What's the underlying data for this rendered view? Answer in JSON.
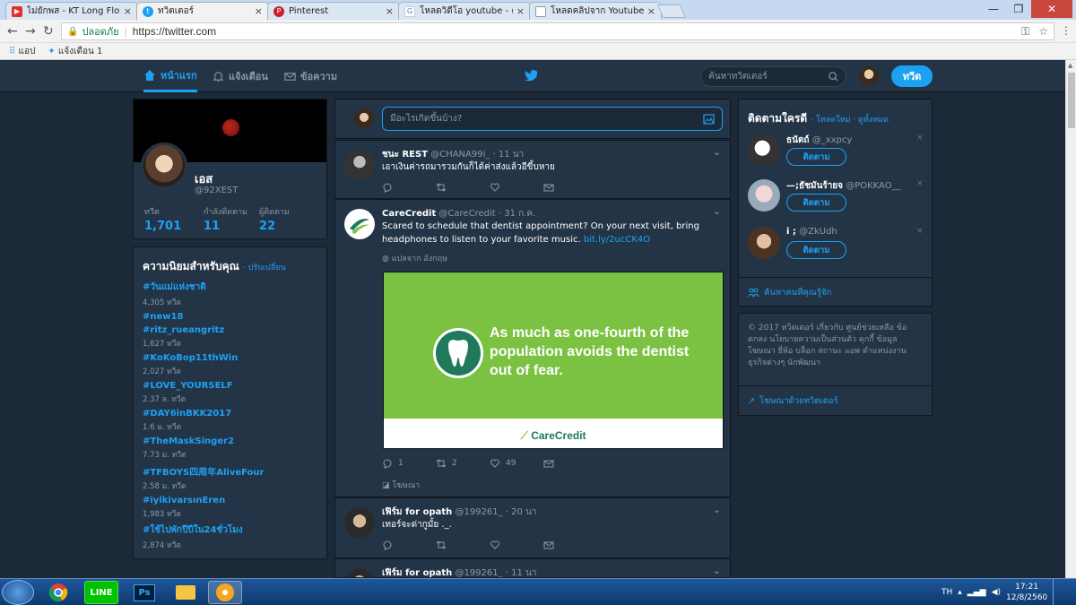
{
  "browser": {
    "tabs": [
      {
        "title": "ไม่ยักพส - KT Long Flowin",
        "favicon": "youtube-icon",
        "active": false
      },
      {
        "title": "ทวิตเตอร์",
        "favicon": "twitter-icon",
        "active": true
      },
      {
        "title": "Pinterest",
        "favicon": "pinterest-icon",
        "active": false
      },
      {
        "title": "โหลดวิดีโอ youtube - ค้นห",
        "favicon": "google-icon",
        "active": false
      },
      {
        "title": "โหลดคลิปจาก Youtube Mp",
        "favicon": "page-icon",
        "active": false
      }
    ],
    "secure_label": "ปลอดภัย",
    "url": "https://twitter.com",
    "bookmarks": [
      "แอป",
      "แจ้งเตือน 1"
    ]
  },
  "nav": {
    "home": "หน้าแรก",
    "notifications": "แจ้งเตือน",
    "messages": "ข้อความ",
    "search_placeholder": "ค้นหาทวิตเตอร์",
    "tweet_button": "ทวีต"
  },
  "profile": {
    "name": "เอส",
    "handle": "@92XEST",
    "stats": [
      {
        "label": "ทวีต",
        "value": "1,701"
      },
      {
        "label": "กำลังติดตาม",
        "value": "11"
      },
      {
        "label": "ผู้ติดตาม",
        "value": "22"
      }
    ]
  },
  "trends": {
    "title": "ความนิยมสำหรับคุณ",
    "change": "· ปรับเปลี่ยน",
    "items": [
      {
        "name": "#วันแม่แห่งชาติ",
        "count": "4,305 ทวีต"
      },
      {
        "name": "#new18",
        "count": ""
      },
      {
        "name": "#ritz_rueangritz",
        "count": "1,627 ทวีต"
      },
      {
        "name": "#KoKoBop11thWin",
        "count": "2,027 ทวีต"
      },
      {
        "name": "#LOVE_YOURSELF",
        "count": "2.37 ล. ทวีต"
      },
      {
        "name": "#DAY6inBKK2017",
        "count": "1.6 ม. ทวีต"
      },
      {
        "name": "#TheMaskSinger2",
        "count": "7.73 ม. ทวีต"
      },
      {
        "name": "#TFBOYS四周年AliveFour",
        "count": "2.58 ม. ทวีต"
      },
      {
        "name": "#iyikivarsınEren",
        "count": "1,983 ทวีต"
      },
      {
        "name": "#ใช้ไปพักปีปีใน24ชั่วโมง",
        "count": "2,874 ทวีต"
      }
    ]
  },
  "compose": {
    "placeholder": "มีอะไรเกิดขึ้นบ้าง?"
  },
  "tweets": [
    {
      "name": "ชนะ REST",
      "handle": "@CHANA99i_",
      "time": "· 11 นา",
      "text": "เอาเงินค่ารถมารวมกันก็ได้ค่าส่งแล้วอีขี้บหาย",
      "reply": "",
      "retweet": "",
      "like": ""
    },
    {
      "name": "CareCredit",
      "handle": "@CareCredit",
      "time": "· 31 ก.ค.",
      "text": "Scared to schedule that dentist appointment? On your next visit, bring headphones to listen to your favorite music.",
      "link": "bit.ly/2ucCK4O",
      "translate": "แปลจาก อังกฤษ",
      "ad_text": "As much as one-fourth of the population avoids the dentist out of fear.",
      "ad_logo": "CareCredit",
      "reply": "1",
      "retweet": "2",
      "like": "49",
      "promoted": "โฆษณา"
    },
    {
      "name": "เฟิร์ม for opath",
      "handle": "@199261_",
      "time": "· 20 นา",
      "text": "เทอร์จะด่ากูมั้ย ._.",
      "reply": "",
      "retweet": "",
      "like": ""
    },
    {
      "name": "เฟิร์ม for opath",
      "handle": "@199261_",
      "time": "· 11 นา",
      "text": ""
    }
  ],
  "who_to_follow": {
    "title": "ติดตามใครดี",
    "refresh": "· โหลดใหม่ · ดูทั้งหมด",
    "users": [
      {
        "name": "ธนัตถ์",
        "handle": "@_xxpcy",
        "button": "ติดตาม"
      },
      {
        "name": "—;ธัชมันร้ายจ",
        "handle": "@POKKAO__",
        "button": "ติดตาม"
      },
      {
        "name": "i ;",
        "handle": "@ZkUdh",
        "button": "ติดตาม"
      }
    ],
    "find_people": "ค้นหาคนที่คุณรู้จัก"
  },
  "footer": {
    "text": "© 2017 ทวิตเตอร์  เกี่ยวกับ  ศูนย์ช่วยเหลือ  ข้อตกลง  นโยบายความเป็นส่วนตัว  คุกกี้  ข้อมูลโฆษณา  ยี่ห้อ  บล็อก  สถานะ  แอพ  ตำแหน่งงาน  ธุรกิจต่างๆ  นักพัฒนา",
    "ads": "โฆษณาด้วยทวิตเตอร์"
  },
  "taskbar": {
    "lang": "TH",
    "time": "17:21",
    "date": "12/8/2560"
  },
  "colors": {
    "accent": "#1da1f2",
    "bg": "#1c2938",
    "panel": "#243447",
    "ad_green": "#7cc242"
  }
}
